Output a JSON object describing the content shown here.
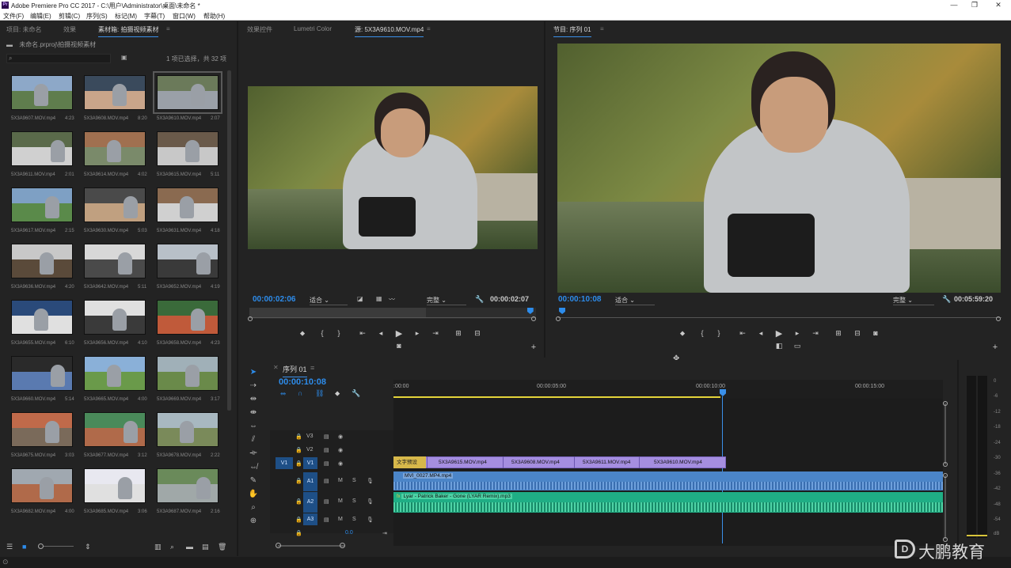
{
  "window": {
    "title": "Adobe Premiere Pro CC 2017 - C:\\用户\\Administrator\\桌面\\未命名 *",
    "logo": "Pr"
  },
  "menu": [
    "文件(F)",
    "编辑(E)",
    "剪辑(C)",
    "序列(S)",
    "标记(M)",
    "字幕(T)",
    "窗口(W)",
    "帮助(H)"
  ],
  "project": {
    "tabs": [
      "项目: 未命名",
      "效果",
      "素材箱: 拍摄视频素材"
    ],
    "path": "未命名.prproj\\拍摄视频素材",
    "search_placeholder": "",
    "selection_info": "1 项已选择，共 32 项",
    "items": [
      {
        "name": "5X3A9607.MOV.mp4",
        "dur": "4:23"
      },
      {
        "name": "5X3A9608.MOV.mp4",
        "dur": "8:20"
      },
      {
        "name": "5X3A9610.MOV.mp4",
        "dur": "2:07"
      },
      {
        "name": "5X3A9611.MOV.mp4",
        "dur": "2:01"
      },
      {
        "name": "5X3A9614.MOV.mp4",
        "dur": "4:02"
      },
      {
        "name": "5X3A9615.MOV.mp4",
        "dur": "5:11"
      },
      {
        "name": "5X3A9617.MOV.mp4",
        "dur": "2:15"
      },
      {
        "name": "5X3A9630.MOV.mp4",
        "dur": "5:03"
      },
      {
        "name": "5X3A9631.MOV.mp4",
        "dur": "4:18"
      },
      {
        "name": "5X3A9636.MOV.mp4",
        "dur": "4:20"
      },
      {
        "name": "5X3A9642.MOV.mp4",
        "dur": "5:11"
      },
      {
        "name": "5X3A9652.MOV.mp4",
        "dur": "4:19"
      },
      {
        "name": "5X3A9655.MOV.mp4",
        "dur": "6:10"
      },
      {
        "name": "5X3A9656.MOV.mp4",
        "dur": "4:10"
      },
      {
        "name": "5X3A9658.MOV.mp4",
        "dur": "4:23"
      },
      {
        "name": "5X3A9660.MOV.mp4",
        "dur": "5:14"
      },
      {
        "name": "5X3A9665.MOV.mp4",
        "dur": "4:00"
      },
      {
        "name": "5X3A9669.MOV.mp4",
        "dur": "3:17"
      },
      {
        "name": "5X3A9675.MOV.mp4",
        "dur": "3:03"
      },
      {
        "name": "5X3A9677.MOV.mp4",
        "dur": "3:12"
      },
      {
        "name": "5X3A9678.MOV.mp4",
        "dur": "2:22"
      },
      {
        "name": "5X3A9682.MOV.mp4",
        "dur": "4:00"
      },
      {
        "name": "5X3A9685.MOV.mp4",
        "dur": "3:06"
      },
      {
        "name": "5X3A9687.MOV.mp4",
        "dur": "2:16"
      }
    ]
  },
  "source": {
    "tabs": [
      "效果控件",
      "Lumetri Color",
      "源: 5X3A9610.MOV.mp4"
    ],
    "timecode": "00:00:02:06",
    "fit": "适合",
    "quality": "完整",
    "duration": "00:00:02:07",
    "playhead": 0.98
  },
  "program": {
    "tab": "节目: 序列 01",
    "timecode": "00:00:10:08",
    "fit": "适合",
    "quality": "完整",
    "duration": "00:05:59:20",
    "playhead": 0.002
  },
  "timeline": {
    "tab": "序列 01",
    "timecode": "00:00:10:08",
    "ruler": [
      ":00:00",
      "00:00:05:00",
      "00:00:10:00",
      "00:00:15:00"
    ],
    "tracks": {
      "v3": "V3",
      "v2": "V2",
      "v1": "V1",
      "src_v1": "V1",
      "a1": "A1",
      "a2": "A2",
      "a3": "A3"
    },
    "mute_label": "M",
    "solo_label": "S",
    "master_value": "0.0",
    "video_clips": [
      "文字预设",
      "5X3A9615.MOV.mp4",
      "5X3A9608.MOV.mp4",
      "5X3A9611.MOV.mp4",
      "5X3A9610.MOV.mp4"
    ],
    "audio_clips": [
      "MVI_0027.MP4.mp4",
      "Lyar - Patrick Baker - Gone (LYAR Remix).mp3"
    ]
  },
  "meter": {
    "labels": [
      "0",
      "-6",
      "-12",
      "-18",
      "-24",
      "-30",
      "-36",
      "-42",
      "-48",
      "-54",
      "dB"
    ]
  },
  "watermark": "大鹏教育",
  "colors": {
    "accent": "#2d8ceb",
    "video_clip": "#a58ee0",
    "audio_clip1": "#4b85c8",
    "audio_clip2": "#1fae85",
    "playhead": "#3a8fe8",
    "workarea": "#e4d43a"
  }
}
